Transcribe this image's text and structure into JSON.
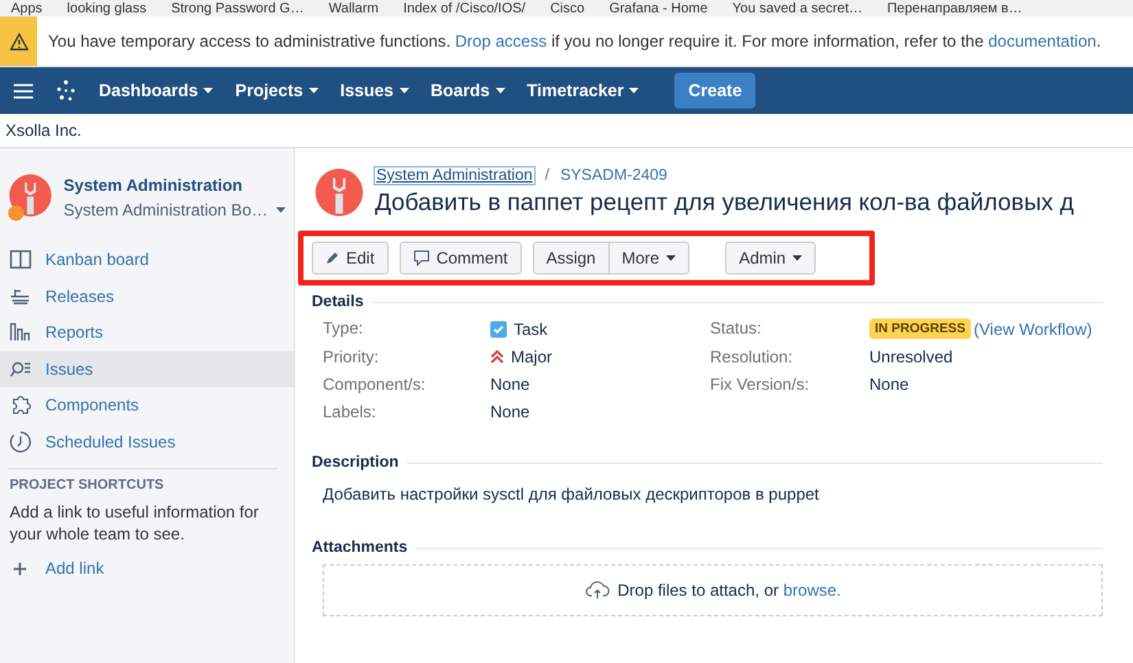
{
  "bookmarks": [
    "Apps",
    "looking glass",
    "Strong Password G…",
    "Wallarm",
    "Index of /Cisco/IOS/",
    "Cisco",
    "Grafana - Home",
    "You saved a secret…",
    "Перенаправляем в…"
  ],
  "banner": {
    "text_before": "You have temporary access to administrative functions.",
    "link": "Drop access",
    "text_middle": "if you no longer require it. For more information, refer to the",
    "link2": "documentation",
    "text_after": "."
  },
  "nav": {
    "menus": [
      "Dashboards",
      "Projects",
      "Issues",
      "Boards",
      "Timetracker"
    ],
    "create": "Create"
  },
  "org": "Xsolla Inc.",
  "sidebar": {
    "project": "System Administration",
    "board": "System Administration Bo…",
    "items": [
      {
        "label": "Kanban board",
        "kind": "board",
        "selected": false
      },
      {
        "label": "Releases",
        "kind": "releases",
        "selected": false
      },
      {
        "label": "Reports",
        "kind": "reports",
        "selected": false
      },
      {
        "label": "Issues",
        "kind": "issues",
        "selected": true
      },
      {
        "label": "Components",
        "kind": "components",
        "selected": false
      },
      {
        "label": "Scheduled Issues",
        "kind": "scheduled",
        "selected": false
      }
    ],
    "shortcuts_title": "PROJECT SHORTCUTS",
    "shortcuts_text": "Add a link to useful information for your whole team to see.",
    "add_link": "Add link"
  },
  "issue": {
    "project_link": "System Administration",
    "separator": "/",
    "key": "SYSADM-2409",
    "title": "Добавить в паппет рецепт для увеличения кол-ва файловых д",
    "buttons": [
      {
        "label": "Edit",
        "kind": "edit"
      },
      {
        "label": "Comment",
        "kind": "comment"
      },
      {
        "label": "Assign",
        "kind": "plain"
      },
      {
        "label": "More",
        "kind": "dropdown"
      },
      {
        "label": "Admin",
        "kind": "dropdown"
      }
    ],
    "details_title": "Details",
    "fields": [
      {
        "label": "Type:",
        "value": "Task",
        "kind": "type"
      },
      {
        "label": "Status:",
        "value": "IN PROGRESS",
        "link": "(View Workflow)",
        "kind": "status"
      },
      {
        "label": "Priority:",
        "value": "Major",
        "kind": "priority"
      },
      {
        "label": "Resolution:",
        "value": "Unresolved",
        "kind": "text"
      },
      {
        "label": "Component/s:",
        "value": "None",
        "kind": "text"
      },
      {
        "label": "Fix Version/s:",
        "value": "None",
        "kind": "text"
      },
      {
        "label": "Labels:",
        "value": "None",
        "kind": "text"
      }
    ],
    "description_title": "Description",
    "description": "Добавить настройки sysctl для файловых дескрипторов в puppet",
    "attachments_title": "Attachments",
    "drop_text": "Drop files to attach, or",
    "browse": "browse."
  }
}
